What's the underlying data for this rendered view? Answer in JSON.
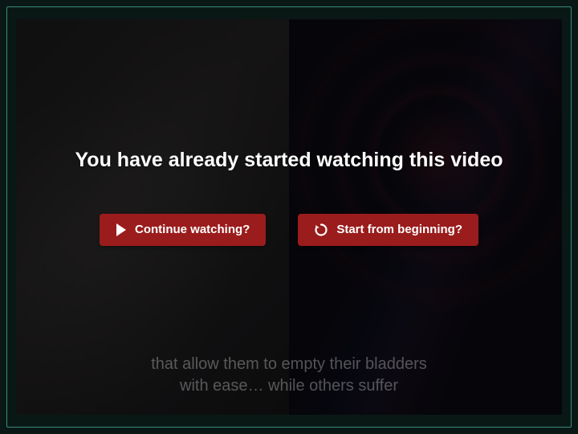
{
  "dialog": {
    "heading": "You have already started watching this video",
    "continue_label": "Continue watching?",
    "restart_label": "Start from beginning?"
  },
  "caption": {
    "line1": "that allow them to empty their bladders",
    "line2": "with ease… while others suffer"
  },
  "colors": {
    "button_bg": "#9b1c1c"
  }
}
